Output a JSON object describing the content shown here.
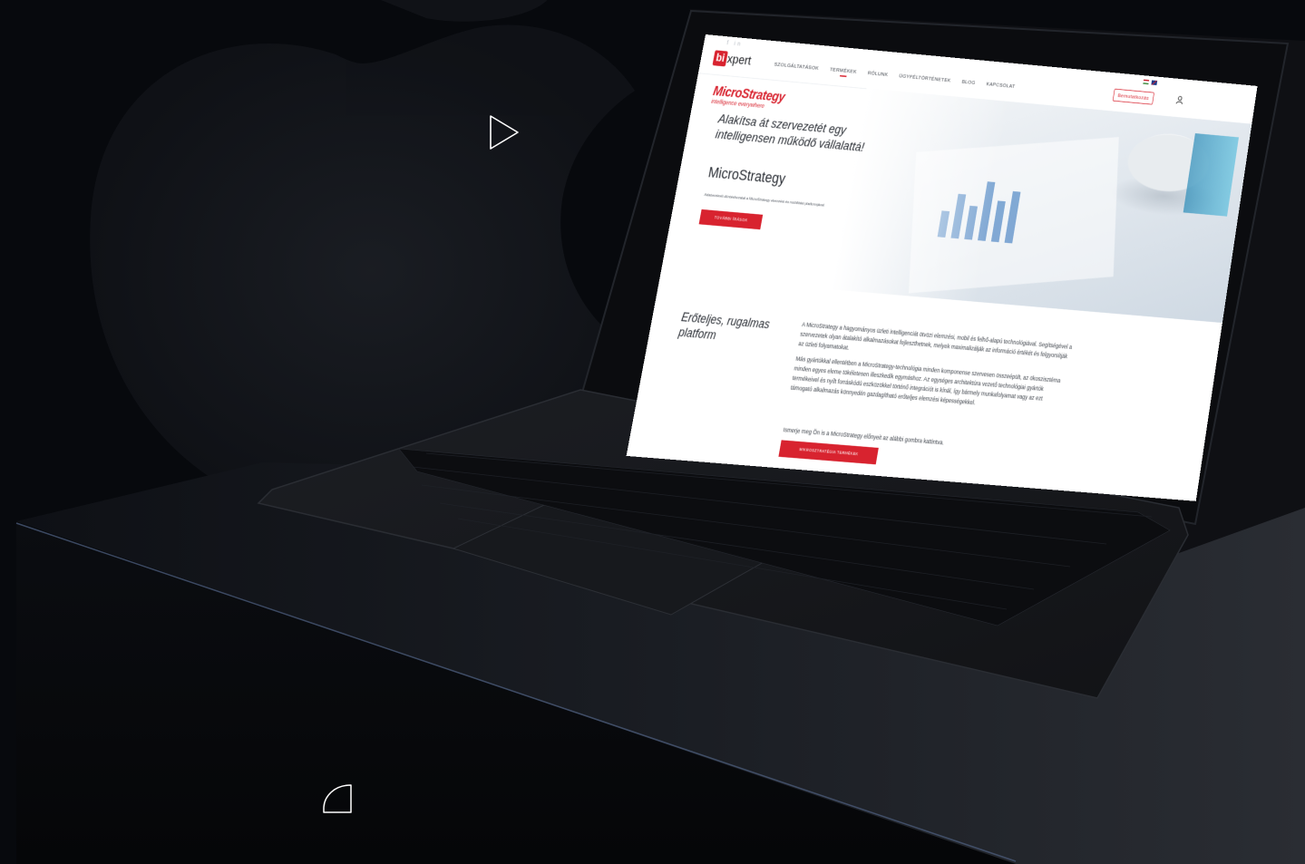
{
  "site": {
    "social": "f in",
    "logo": {
      "bi": "bi",
      "xpert": "xpert"
    },
    "nav": [
      "Szolgáltatások",
      "Termékek",
      "Rólunk",
      "Ügyféltörténetek",
      "Blog",
      "Kapcsolat"
    ],
    "nav_active_index": 1,
    "cta": "Bemutatkozás",
    "brand": {
      "name": "MicroStrategy",
      "tagline": "intelligence everywhere"
    },
    "hero_title": "Alakítsa át szervezetét egy intelligensen működő vállalattá!",
    "hero_subtitle": "MicroStrategy",
    "hero_small": "Adatvezérelt döntéshozatal a MicroStrategy elemzési és mobilitási platformjával",
    "hero_button": "TOVÁBBI ÍRÁSOK",
    "section_title": "Erőteljes, rugalmas platform",
    "body_p1": "A MicroStrategy a hagyományos üzleti intelligenciát ötvözi elemzési, mobil és felhő-alapú technológiával. Segítségével a szervezetek olyan átalakító alkalmazásokat fejleszthetnek, melyek maximalizálják az információ értékét és felgyorsítják az üzleti folyamatokat.",
    "body_p2": "Más gyártókkal ellentétben a MicroStrategy-technológia minden komponense szervesen összeépült, az ökoszisztéma minden egyes eleme tökéletesen illeszkedik egymáshoz. Az egységes architektúra vezető technológiai gyártók termékeivel és nyílt forráskódú eszközökkel történő integrációt is kínál, így bármely munkafolyamat vagy az ezt támogató alkalmazás könnyedén gazdagítható erőteljes elemzési képességekkel.",
    "body_note": "Ismerje meg Ön is a MicroStrategy előnyeit az alábbi gombra kattintva.",
    "body_button": "MIKROSZTRATÉGIA TERMÉKEK"
  },
  "chart_bars": [
    0.35,
    0.6,
    0.45,
    0.8,
    0.55,
    0.7
  ],
  "colors": {
    "brand_red": "#d8232f",
    "background": "#07090d"
  },
  "icons": [
    "play-icon",
    "corner-icon",
    "user-icon"
  ]
}
